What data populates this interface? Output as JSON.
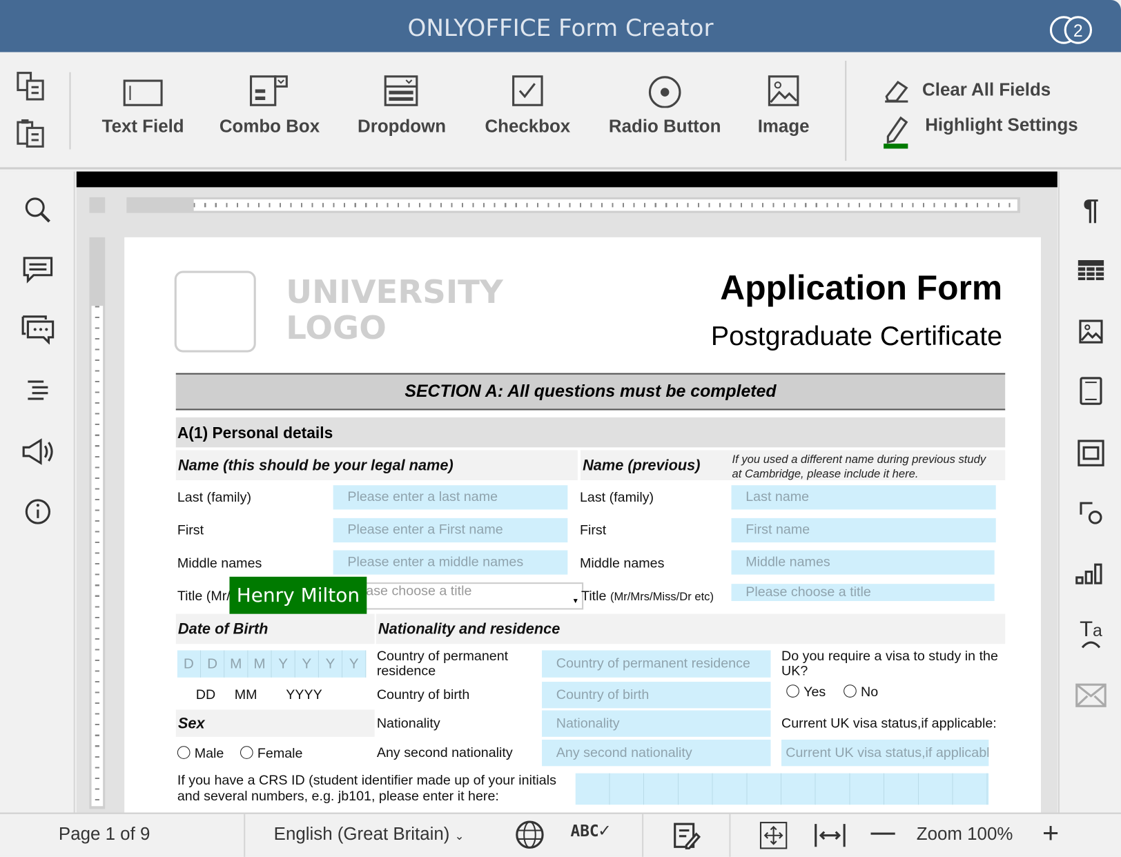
{
  "app": {
    "title": "ONLYOFFICE Form Creator",
    "users_count": "2"
  },
  "toolbar": {
    "buttons": [
      {
        "label": "Text Field",
        "icon": "text-field-icon"
      },
      {
        "label": "Combo Box",
        "icon": "combo-box-icon"
      },
      {
        "label": "Dropdown",
        "icon": "dropdown-icon"
      },
      {
        "label": "Checkbox",
        "icon": "checkbox-icon"
      },
      {
        "label": "Radio Button",
        "icon": "radio-button-icon"
      },
      {
        "label": "Image",
        "icon": "image-icon"
      }
    ],
    "clear_all": "Clear All Fields",
    "highlight": "Highlight Settings",
    "highlight_color": "#007a00"
  },
  "document": {
    "logo": "UNIVERSITY LOGO",
    "logo_line1": "UNIVERSITY",
    "logo_line2": "LOGO",
    "title": "Application Form",
    "subtitle": "Postgraduate Certificate",
    "section": "SECTION A: All questions must be completed",
    "personal": "A(1) Personal details",
    "name_legal": "Name (this should be your legal name)",
    "name_prev": "Name (previous)",
    "name_prev_note": "If you used a different name during previous study at Cambridge, please include it here.",
    "rows": [
      {
        "label": "Last (family)",
        "placeholder": "Please enter a last name",
        "prev_label": "Last (family)",
        "prev_placeholder": "Last name"
      },
      {
        "label": "First",
        "placeholder": "Please enter a First name",
        "prev_label": "First",
        "prev_placeholder": "First name"
      },
      {
        "label": "Middle names",
        "placeholder": "Please enter a middle names",
        "prev_label": "Middle names",
        "prev_placeholder": "Middle names"
      }
    ],
    "title_label": "Title (Mr/",
    "title_placeholder": "ase choose a title",
    "prev_title_label": "Title",
    "prev_title_hint": "(Mr/Mrs/Miss/Dr etc)",
    "prev_title_placeholder": "Please choose a title",
    "user_tag": "Henry Milton",
    "user_tag_color": "#007a00",
    "dob": "Date of Birth",
    "dob_cells": [
      "D",
      "D",
      "M",
      "M",
      "Y",
      "Y",
      "Y",
      "Y"
    ],
    "dob_dd": "DD",
    "dob_mm": "MM",
    "dob_yyyy": "YYYY",
    "sex": "Sex",
    "male": "Male",
    "female": "Female",
    "nationality_hdr": "Nationality and residence",
    "nat_rows": [
      {
        "label": "Country of permanent residence",
        "placeholder": "Country of permanent residence"
      },
      {
        "label": "Country of birth",
        "placeholder": "Country of birth"
      },
      {
        "label": "Nationality",
        "placeholder": "Nationality"
      },
      {
        "label": "Any second nationality",
        "placeholder": "Any second nationality"
      }
    ],
    "visa_q": "Do you require a visa to study in the UK?",
    "yes": "Yes",
    "no": "No",
    "visa_status": "Current UK visa status,if applicable:",
    "visa_status_placeholder": "Current UK visa status,if applicable",
    "crs": "If you have a CRS ID (student identifier made up of your initials and several numbers, e.g. jb101, please enter it here:"
  },
  "status": {
    "page": "Page 1 of 9",
    "language": "English  (Great Britain)",
    "zoom": "Zoom 100%"
  }
}
